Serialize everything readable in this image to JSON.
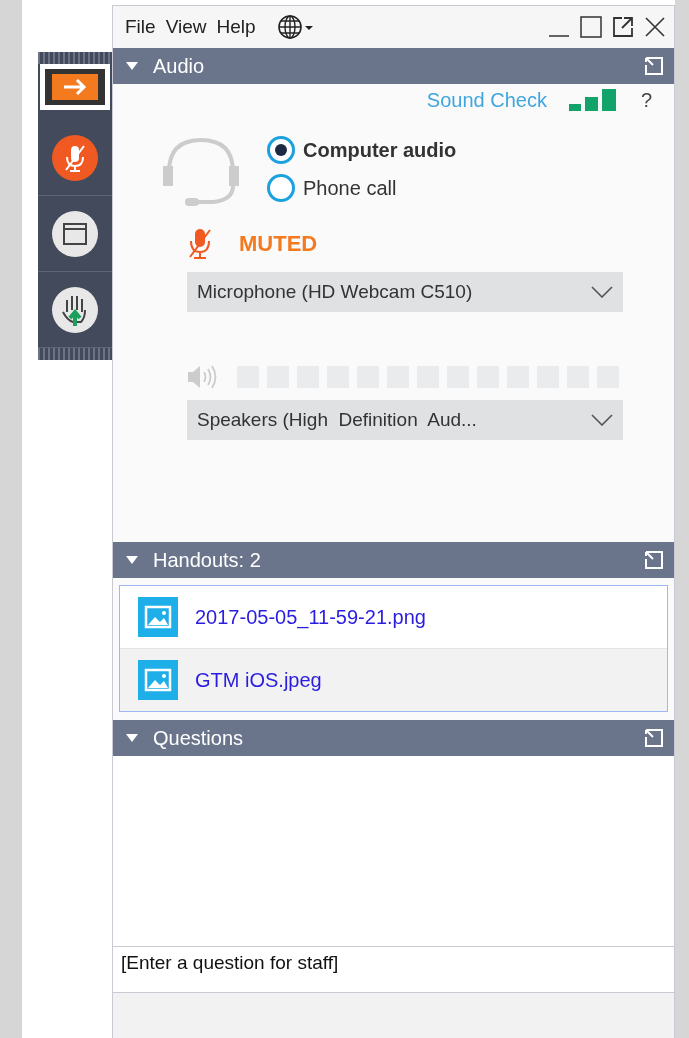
{
  "menu": [
    "File",
    "View",
    "Help"
  ],
  "toolbar": [
    {
      "kind": "arrow",
      "selected": true
    },
    {
      "kind": "mic",
      "selected": false
    },
    {
      "kind": "window",
      "selected": false
    },
    {
      "kind": "hand",
      "selected": false
    }
  ],
  "audio": {
    "title": "Audio",
    "expanded": true,
    "sound_check": "Sound Check",
    "help": "?",
    "options": [
      {
        "label": "Computer audio",
        "selected": true
      },
      {
        "label": "Phone call",
        "selected": false
      }
    ],
    "muted": true,
    "muted_label": "MUTED",
    "microphone": "Microphone (HD Webcam C510)",
    "speaker_meter": {
      "level": 0
    },
    "speakers": "Speakers (High  Definition  Aud..."
  },
  "handouts": {
    "title": "Handouts: 2",
    "expanded": true,
    "files": [
      {
        "name": "2017-05-05_11-59-21.png",
        "selected": false
      },
      {
        "name": "GTM iOS.jpeg",
        "selected": true
      }
    ]
  },
  "questions": {
    "title": "Questions",
    "expanded": true,
    "placeholder": "[Enter a question for staff]"
  }
}
